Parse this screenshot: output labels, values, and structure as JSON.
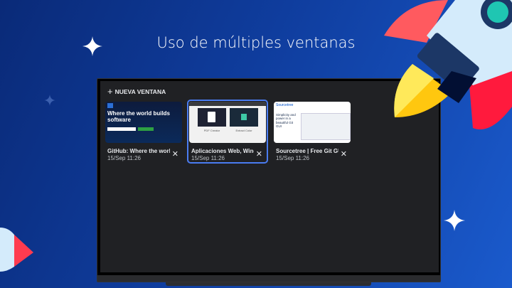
{
  "heading": "Uso de múltiples ventanas",
  "new_window_label": "NUEVA VENTANA",
  "windows": [
    {
      "title": "GitHub: Where the world b...",
      "date": "15/Sep 11:26",
      "thumb_text": "Where the world builds software",
      "selected": false
    },
    {
      "title": "Aplicaciones Web, Winddo...",
      "date": "15/Sep 11:26",
      "thumb_items": [
        "PDF Creator",
        "Extract Color"
      ],
      "selected": true
    },
    {
      "title": "Sourcetree | Free Git GUI f...",
      "date": "15/Sep 11:26",
      "thumb_text": "Simplicity and power in a beautiful Git GUI",
      "thumb_brand": "Sourcetree",
      "selected": false
    }
  ],
  "colors": {
    "selected_border": "#4a7cf0",
    "screen_bg": "#202124"
  }
}
